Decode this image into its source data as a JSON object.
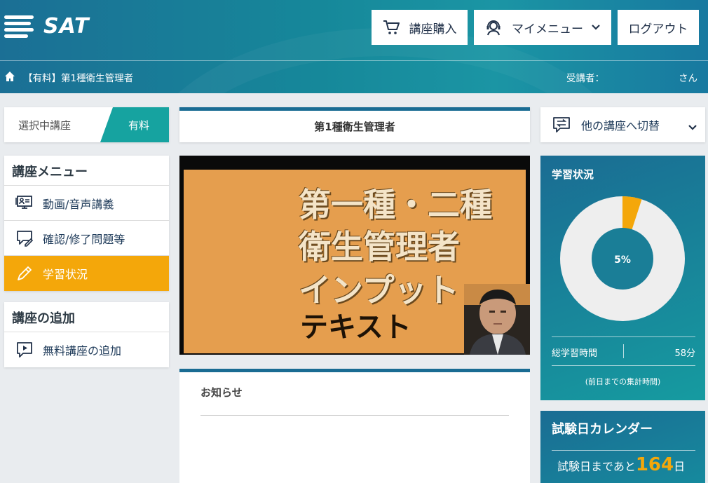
{
  "header": {
    "logo_text": "SAT",
    "buttons": {
      "purchase": "講座購入",
      "my_menu": "マイメニュー",
      "logout": "ログアウト"
    },
    "breadcrumb": "【有料】第1種衛生管理者",
    "student_label": "受講者：",
    "student_suffix": "さん"
  },
  "left": {
    "selected_course_label": "選択中講座",
    "selected_course_tag": "有料",
    "course_menu": {
      "title": "講座メニュー",
      "items": [
        {
          "label": "動画/音声講義",
          "icon": "video-lecture-icon"
        },
        {
          "label": "確認/修了問題等",
          "icon": "quiz-icon"
        },
        {
          "label": "学習状況",
          "icon": "pencil-icon",
          "active": true
        }
      ]
    },
    "add_menu": {
      "title": "講座の追加",
      "items": [
        {
          "label": "無料講座の追加",
          "icon": "play-chat-icon"
        }
      ]
    }
  },
  "center": {
    "course_title": "第1種衛生管理者",
    "video": {
      "lines": [
        "第一種・二種",
        "衛生管理者",
        "インプット",
        "テキスト"
      ]
    },
    "notice_title": "お知らせ"
  },
  "right": {
    "switch_label": "他の講座へ切替",
    "progress": {
      "title": "学習状況",
      "percent": 5,
      "percent_label": "5%",
      "total_time_label": "総学習時間",
      "total_time_value": "58分",
      "note": "(前日までの集計時間)",
      "colors": {
        "done": "#f4a70a",
        "remaining": "#eeeeee",
        "center": "#1a7e97"
      }
    },
    "calendar": {
      "title": "試験日カレンダー",
      "prefix": "試験日まであと",
      "days": "164",
      "suffix": "日"
    }
  }
}
